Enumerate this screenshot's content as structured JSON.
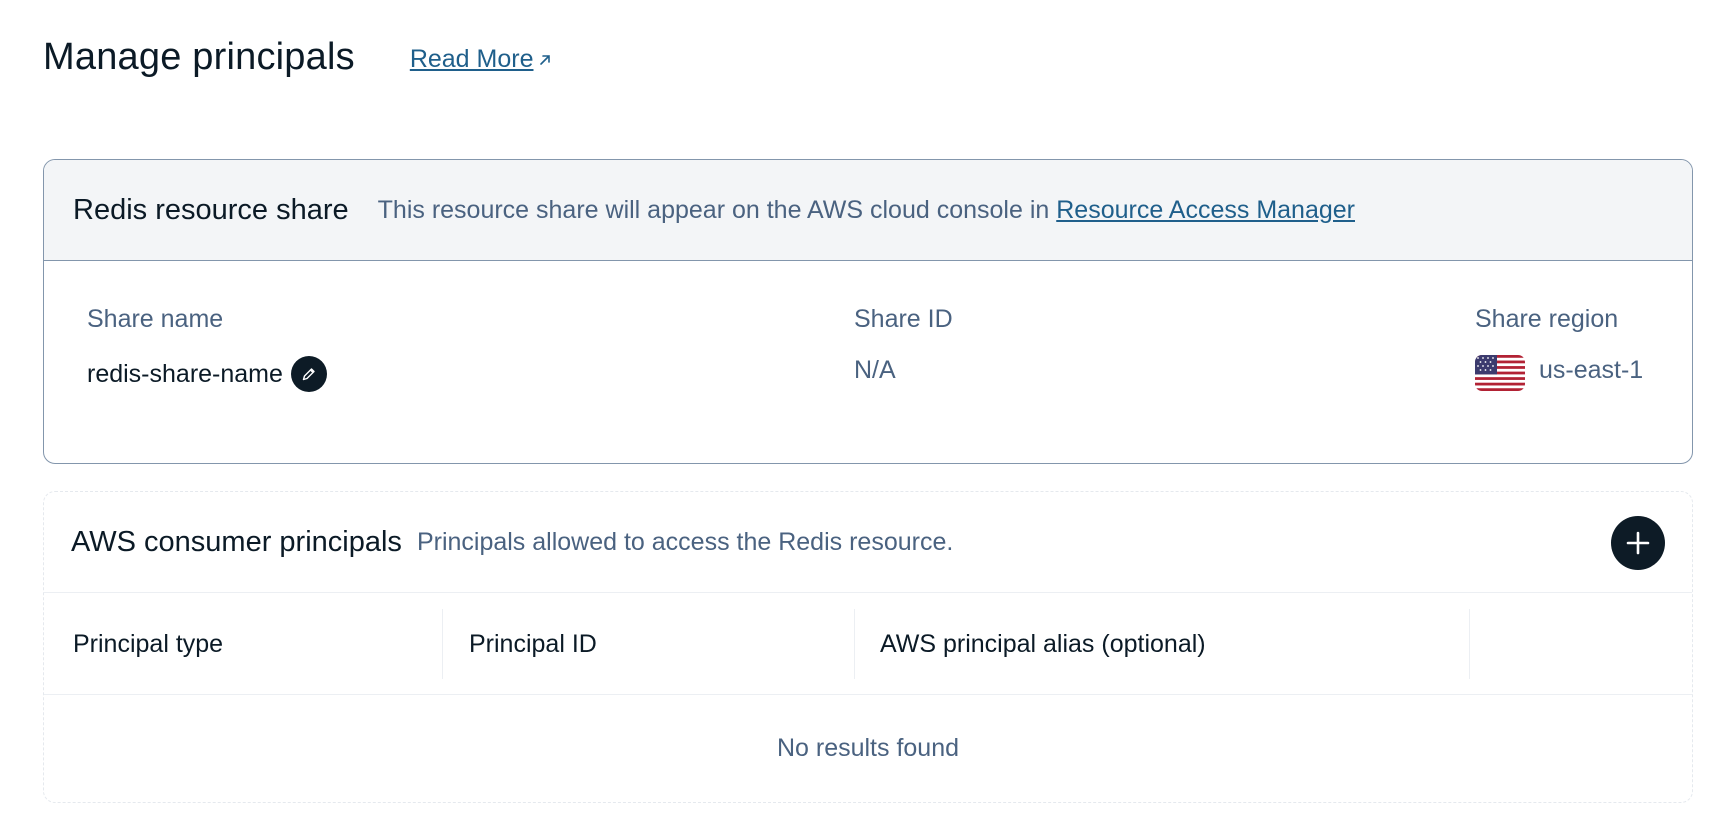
{
  "header": {
    "title": "Manage principals",
    "read_more": "Read More"
  },
  "share_card": {
    "title": "Redis resource share",
    "description": "This resource share will appear on the AWS cloud console in ",
    "link": "Resource Access Manager",
    "fields": {
      "name_label": "Share name",
      "name_value": "redis-share-name",
      "id_label": "Share ID",
      "id_value": "N/A",
      "region_label": "Share region",
      "region_value": "us-east-1"
    }
  },
  "principals_card": {
    "title": "AWS consumer principals",
    "description": "Principals allowed to access the Redis resource.",
    "columns": [
      "Principal type",
      "Principal ID",
      "AWS principal alias (optional)"
    ],
    "empty_text": "No results found"
  },
  "colors": {
    "accent_dark": "#0d1b26",
    "link": "#1f5f8b",
    "muted_text": "#4a6280",
    "border": "#8396ac"
  },
  "icons": {
    "external_link": "external-link-icon",
    "edit": "pencil-icon",
    "flag": "us-flag-icon",
    "add": "plus-icon"
  }
}
